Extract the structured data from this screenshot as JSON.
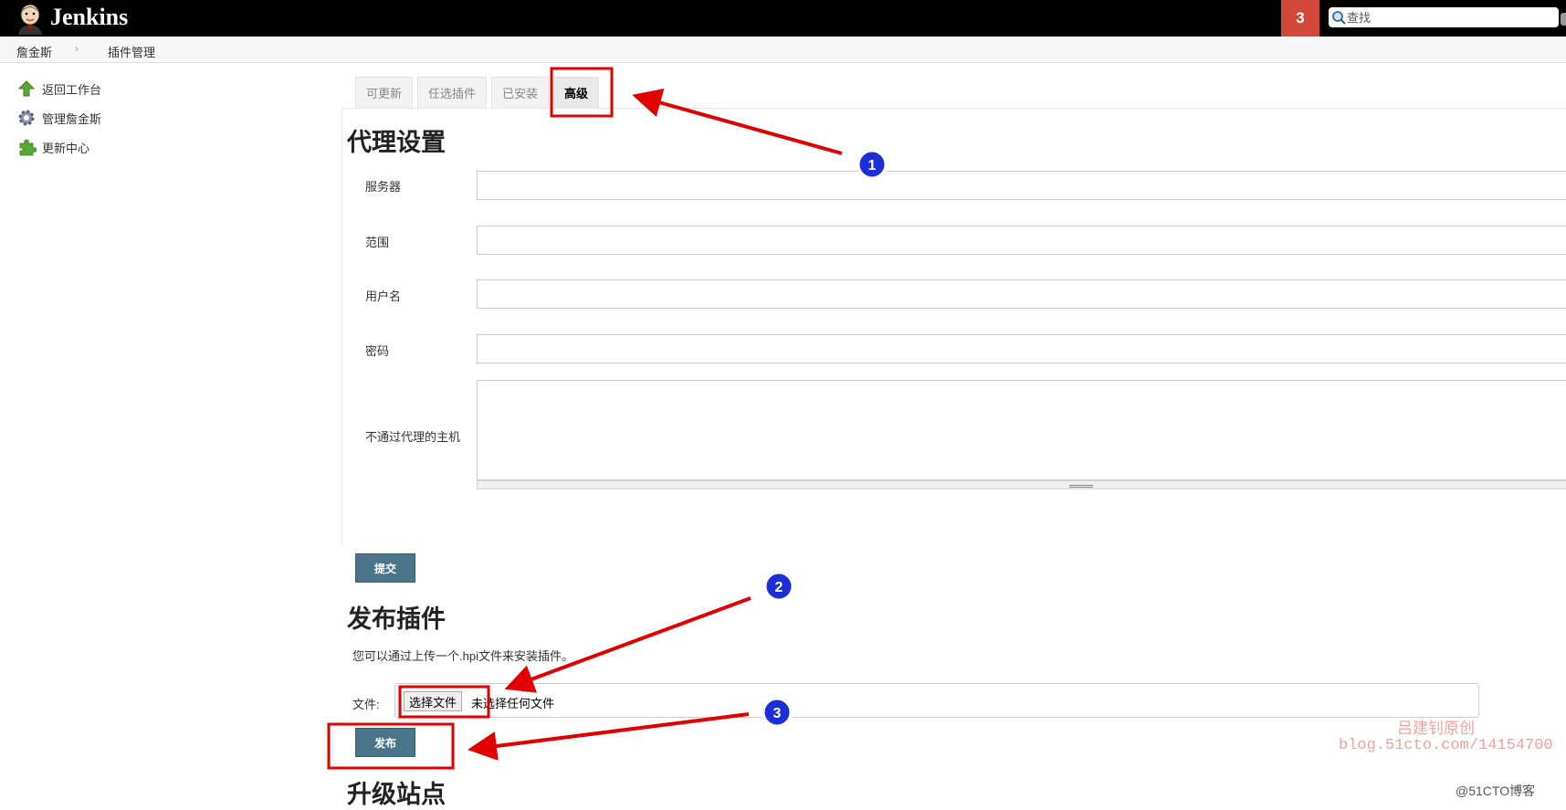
{
  "header": {
    "app_name": "Jenkins",
    "notification_count": "3",
    "search_placeholder": "查找"
  },
  "breadcrumb": [
    "詹金斯",
    "插件管理"
  ],
  "sidebar": {
    "items": [
      {
        "label": "返回工作台",
        "icon": "up-arrow-icon"
      },
      {
        "label": "管理詹金斯",
        "icon": "gear-icon"
      },
      {
        "label": "更新中心",
        "icon": "puzzle-icon"
      }
    ]
  },
  "tabs": [
    {
      "label": "可更新",
      "active": false
    },
    {
      "label": "任选插件",
      "active": false
    },
    {
      "label": "已安装",
      "active": false
    },
    {
      "label": "高级",
      "active": true
    }
  ],
  "proxy": {
    "title": "代理设置",
    "fields": [
      {
        "label": "服务器",
        "value": ""
      },
      {
        "label": "范围",
        "value": ""
      },
      {
        "label": "用户名",
        "value": ""
      },
      {
        "label": "密码",
        "value": ""
      },
      {
        "label": "不通过代理的主机",
        "value": ""
      }
    ],
    "submit_label": "提交"
  },
  "upload": {
    "title": "发布插件",
    "description": "您可以通过上传一个.hpi文件来安装插件。",
    "file_label": "文件:",
    "choose_label": "选择文件",
    "no_file_text": "未选择任何文件",
    "submit_label": "发布"
  },
  "update_site": {
    "title": "升级站点"
  },
  "annotations": {
    "markers": [
      "1",
      "2",
      "3"
    ],
    "color": "#e00000"
  },
  "watermark": {
    "line1": "吕建钊原创",
    "line2": "blog.51cto.com/14154700",
    "line3": "@51CTO博客"
  }
}
